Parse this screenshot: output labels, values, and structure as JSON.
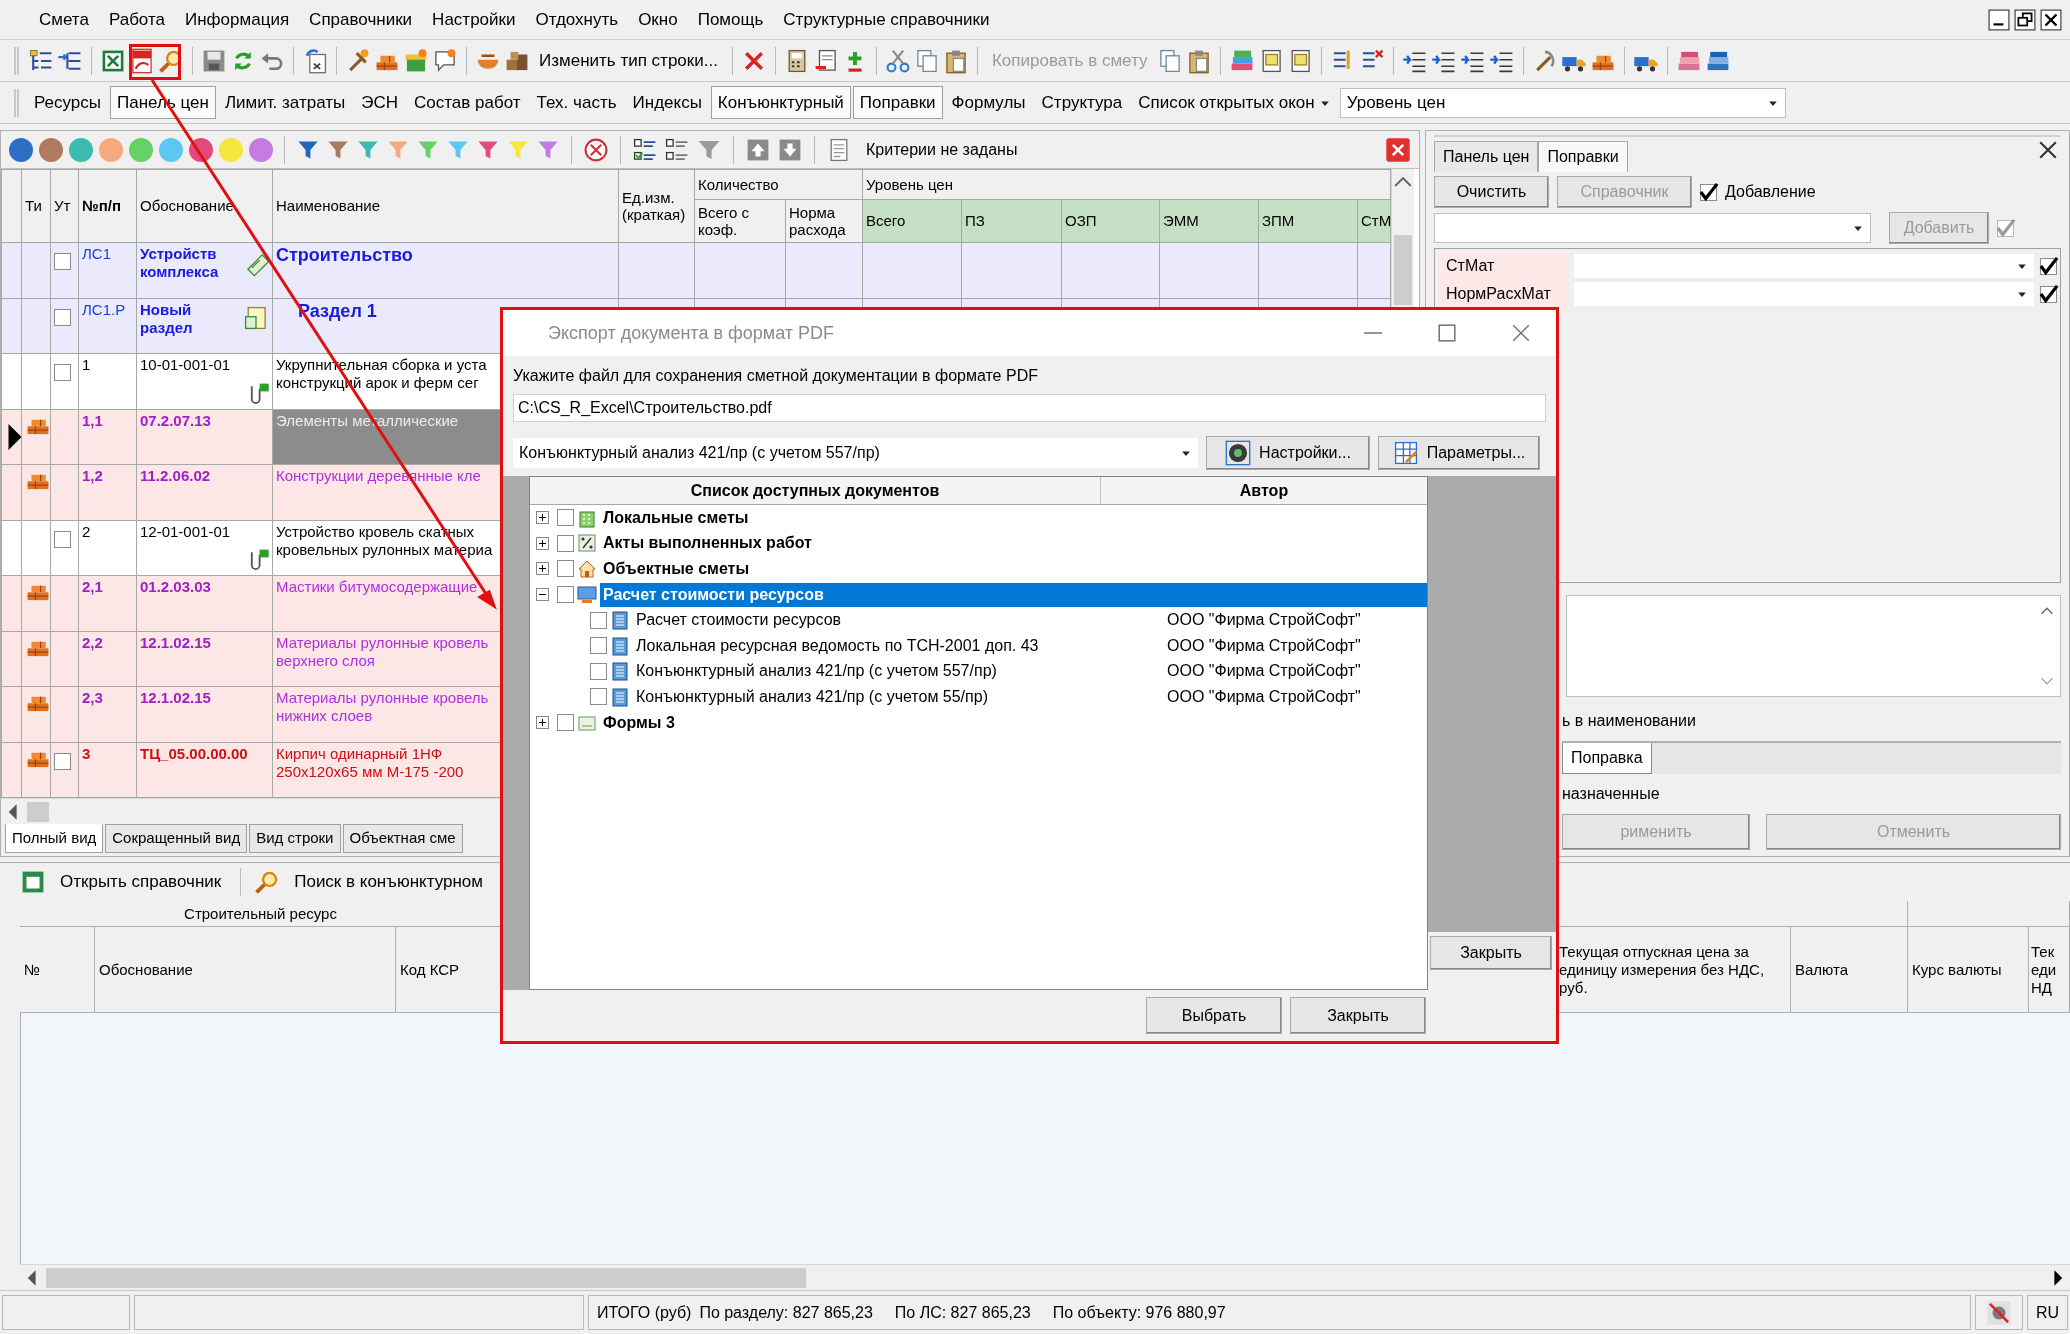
{
  "menu": [
    "Смета",
    "Работа",
    "Информация",
    "Справочники",
    "Настройки",
    "Отдохнуть",
    "Окно",
    "Помощь",
    "Структурные справочники"
  ],
  "toolbar": {
    "buttons": [
      {
        "label": "Изменить тип строки...",
        "disabled": false
      },
      {
        "label": "Копировать в смету",
        "disabled": true
      }
    ]
  },
  "view_tabs": [
    {
      "label": "Ресурсы",
      "selected": false
    },
    {
      "label": "Панель цен",
      "selected": true
    },
    {
      "label": "Лимит. затраты",
      "selected": false
    },
    {
      "label": "ЭСН",
      "selected": false
    },
    {
      "label": "Состав работ",
      "selected": false
    },
    {
      "label": "Тех. часть",
      "selected": false
    },
    {
      "label": "Индексы",
      "selected": false
    },
    {
      "label": "Конъюнктурный",
      "selected": true
    },
    {
      "label": "Поправки",
      "selected": true
    },
    {
      "label": "Формулы",
      "selected": false
    },
    {
      "label": "Структура",
      "selected": false
    }
  ],
  "open_windows_menu": "Список открытых окон",
  "price_level": "Уровень цен",
  "color_filters": [
    {
      "color": "#2e6fc4"
    },
    {
      "color": "#b07a5e"
    },
    {
      "color": "#3cbcb0"
    },
    {
      "color": "#f7a97e"
    },
    {
      "color": "#66d166"
    },
    {
      "color": "#5cc8f2"
    },
    {
      "color": "#e24a7e"
    },
    {
      "color": "#f7e63e"
    },
    {
      "color": "#c67ae2"
    }
  ],
  "funnel_filters": [
    {
      "color": "#1f68b8"
    },
    {
      "color": "#a67a5c"
    },
    {
      "color": "#3cbcb0"
    },
    {
      "color": "#f7a97e"
    },
    {
      "color": "#66d166"
    },
    {
      "color": "#5cc8f2"
    },
    {
      "color": "#e24a7e"
    },
    {
      "color": "#f7e63e"
    },
    {
      "color": "#c67ae2"
    }
  ],
  "criteria": "Критерии не заданы",
  "grid": {
    "columns": [
      "Ти",
      "Ут",
      "№п/п",
      "Обоснование",
      "Наименование",
      "Ед.изм. (краткая)"
    ],
    "groups": [
      {
        "label": "Количество",
        "columns": [
          "Всего с коэф.",
          "Норма расхода"
        ]
      },
      {
        "label": "Уровень цен",
        "columns": [
          "Всего",
          "ПЗ",
          "ОЗП",
          "ЭММ",
          "ЗПМ",
          "СтМ"
        ]
      }
    ],
    "rows": [
      {
        "kind": "estimate",
        "num": "ЛС1",
        "code": "Устройств комплекса",
        "name": "Строительство",
        "checked": false,
        "selected": false
      },
      {
        "kind": "section",
        "num": "ЛС1.Р",
        "code": "Новый раздел",
        "name": "Раздел 1",
        "checked": false,
        "selected": false
      },
      {
        "kind": "work",
        "num": "1",
        "code": "10-01-001-01",
        "name": "Укрупнительная сборка и уста конструкций арок и ферм сег",
        "checked": false,
        "selected": false
      },
      {
        "kind": "resource",
        "num": "1,1",
        "code": "07.2.07.13",
        "name": "Элементы металлические",
        "selected": true
      },
      {
        "kind": "resource",
        "num": "1,2",
        "code": "11.2.06.02",
        "name": "Конструкции деревянные кле",
        "selected": false
      },
      {
        "kind": "work",
        "num": "2",
        "code": "12-01-001-01",
        "name": "Устройство кровель скатных кровельных рулонных материа",
        "checked": false,
        "selected": false
      },
      {
        "kind": "resource",
        "num": "2,1",
        "code": "01.2.03.03",
        "name": "Мастики битумосодержащие",
        "selected": false
      },
      {
        "kind": "resource",
        "num": "2,2",
        "code": "12.1.02.15",
        "name": "Материалы рулонные кровель верхнего слоя",
        "selected": false
      },
      {
        "kind": "resource",
        "num": "2,3",
        "code": "12.1.02.15",
        "name": "Материалы рулонные кровель нижних слоев",
        "selected": false
      },
      {
        "kind": "price",
        "num": "3",
        "code": "ТЦ_05.00.00.00",
        "name": "Кирпич одинарный 1НФ 250х120х65 мм М-175 -200",
        "checked": false,
        "selected": false
      }
    ]
  },
  "grid_tabs": [
    {
      "label": "Полный вид",
      "selected": true
    },
    {
      "label": "Сокращенный вид",
      "selected": false
    },
    {
      "label": "Вид строки",
      "selected": false
    },
    {
      "label": "Объектная сме",
      "selected": false
    }
  ],
  "right_panel": {
    "tabs": [
      {
        "label": "Панель цен",
        "selected": false
      },
      {
        "label": "Поправки",
        "selected": true
      }
    ],
    "clear_button": {
      "label": "Очистить",
      "disabled": false
    },
    "reference_button": {
      "label": "Справочник",
      "disabled": true
    },
    "add_option": {
      "label": "Добавление",
      "checked": true
    },
    "add_button": {
      "label": "Добавить",
      "disabled": true
    },
    "add_check": {
      "checked": true,
      "disabled": true
    },
    "corrections": [
      {
        "name": "СтМат",
        "checked": true
      },
      {
        "name": "НормРасхМат",
        "checked": true
      }
    ],
    "search_hint": "ь в наименовании",
    "sub_tab": "Поправка",
    "assigned": "назначенные",
    "apply_button": {
      "label": "рименить",
      "disabled": true
    },
    "cancel_button": {
      "label": "Отменить",
      "disabled": true
    }
  },
  "bottom_panel": {
    "toolbar": [
      "Открыть справочник",
      "Поиск в конъюнктурном"
    ],
    "group": "Строительный ресурс",
    "columns": [
      "№",
      "Обоснование",
      "Код КСР"
    ],
    "right_columns": [
      "Текущая отпускная цена за единицу измерения без НДС, руб.",
      "Валюта",
      "Курс валюты",
      "Тек еди НД"
    ]
  },
  "status_bar": {
    "total": "ИТОГО (руб)",
    "section": "По разделу: 827 865,23",
    "estimate": "По ЛС: 827 865,23",
    "object": "По объекту: 976 880,97",
    "language": "RU"
  },
  "dialog": {
    "title": "Экспорт документа в формат PDF",
    "prompt": "Укажите файл для сохранения сметной документации в формате PDF",
    "path": "C:\\CS_R_Excel\\Строительство.pdf",
    "template": "Конъюнктурный анализ 421/пр (с учетом 557/пр)",
    "settings_button": "Настройки...",
    "params_button": "Параметры...",
    "columns": [
      "Список доступных документов",
      "Автор"
    ],
    "tree": [
      {
        "kind": "local",
        "label": "Локальные сметы",
        "checked": false,
        "expanded": false,
        "selected": false
      },
      {
        "kind": "acts",
        "label": "Акты выполненных работ",
        "checked": false,
        "expanded": false,
        "selected": false
      },
      {
        "kind": "object",
        "label": "Объектные сметы",
        "checked": false,
        "expanded": false,
        "selected": false
      },
      {
        "kind": "resources",
        "label": "Расчет стоимости ресурсов",
        "checked": false,
        "expanded": true,
        "selected": true,
        "children": [
          {
            "kind": "document",
            "label": "Расчет стоимости ресурсов",
            "author": "ООО \"Фирма СтройСофт\"",
            "checked": false,
            "selected": false
          },
          {
            "kind": "document",
            "label": "Локальная ресурсная ведомость по ТСН-2001 доп. 43",
            "author": "ООО \"Фирма СтройСофт\"",
            "checked": false,
            "selected": false
          },
          {
            "kind": "document",
            "label": "Конъюнктурный анализ 421/пр (с учетом 557/пр)",
            "author": "ООО \"Фирма СтройСофт\"",
            "checked": false,
            "selected": false
          },
          {
            "kind": "document",
            "label": "Конъюнктурный анализ 421/пр (с учетом 55/пр)",
            "author": "ООО \"Фирма СтройСофт\"",
            "checked": false,
            "selected": false
          }
        ]
      },
      {
        "kind": "forms",
        "label": "Формы 3",
        "checked": false,
        "expanded": false,
        "selected": false
      }
    ],
    "behind_button": "Закрыть",
    "buttons": [
      "Выбрать",
      "Закрыть"
    ]
  }
}
